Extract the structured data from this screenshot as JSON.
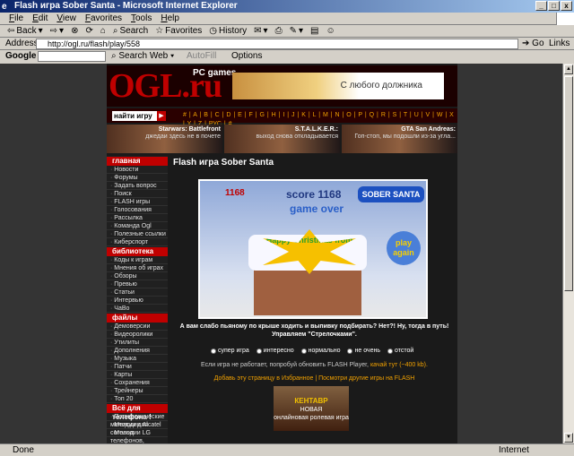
{
  "window": {
    "title": "Flash игра Sober Santa - Microsoft Internet Explorer",
    "buttons": [
      "_",
      "□",
      "x"
    ]
  },
  "menu": [
    "File",
    "Edit",
    "View",
    "Favorites",
    "Tools",
    "Help"
  ],
  "toolbar": {
    "back": "Back",
    "search": "Search",
    "favorites": "Favorites",
    "history": "History"
  },
  "address": {
    "label": "Address",
    "url": "http://ogl.ru/flash/play/558",
    "go": "Go",
    "links": "Links"
  },
  "google": {
    "label": "Google",
    "search_web": "Search Web",
    "autofill": "AutoFill",
    "options": "Options"
  },
  "site": {
    "logo": "OGL.ru",
    "logo_sub": "PC games",
    "banner": "С любого должника",
    "search_label": "найти игру",
    "alphabet": "# | A | B | C | D | E | F | G | H | I | J | K | L | M | N | O | P | Q | R | S | T | U | V | W | X | Y | Z | РУС | #",
    "promos": [
      {
        "title": "Starwars: Battlefront",
        "text": "джедаи здесь не в почете"
      },
      {
        "title": "S.T.A.L.K.E.R.:",
        "text": "выход снова откладывается"
      },
      {
        "title": "GTA San Andreas:",
        "text": "Гоп-стоп, мы подошли из-за угла..."
      }
    ],
    "sidebar": [
      {
        "section": "главная",
        "items": [
          "Новости",
          "Форумы",
          "Задать вопрос",
          "Поиск",
          "FLASH игры",
          "Голосования",
          "Рассылка",
          "Команда Ogl",
          "Полезные ссылки",
          "Киберспорт"
        ]
      },
      {
        "section": "библиотека",
        "items": [
          "Коды к играм",
          "Мнения об играх",
          "Обзоры",
          "Превью",
          "Статьи",
          "Интервью",
          "ЧаВо"
        ]
      },
      {
        "section": "файлы",
        "items": [
          "Демоверсии",
          "Видеоролики",
          "Утилиты",
          "Дополнения",
          "Музыка",
          "Патчи",
          "Карты",
          "Сохранения",
          "Трейнеры",
          "Топ 20"
        ]
      },
      {
        "section": "Всё для телефона !",
        "items": [
          "Полифонические мелодии для сотовых телефонов, картинки",
          "Мелодии Alcatel",
          "Мелодии LG"
        ]
      }
    ],
    "page_title": "Flash игра Sober Santa",
    "game": {
      "highscore": "1168",
      "score_label": "score 1168",
      "game_over": "game over",
      "brand": "SOBER SANTA",
      "greeting": "Happy Christmas from",
      "play": "play again"
    },
    "description": "А вам слабо пьяному по крыше ходить и выпивку подбирать? Нет?! Ну, тогда в путь! Управляем \"Стрелочками\".",
    "rating": [
      "супер игра",
      "интересно",
      "нормально",
      "не очень",
      "отстой"
    ],
    "flash_note": "Если игра не работает, попробуй обновить FLASH Player,",
    "flash_link": "качай тут (~400 kb).",
    "fav_links": "Добавь эту страницу в Избранное | Посмотри другие игры на FLASH",
    "ad": {
      "title": "КЕНТАВР",
      "sub": "НОВАЯ",
      "text": "онлайновая ролевая игра"
    }
  },
  "status": {
    "text": "Done",
    "zone": "Internet"
  }
}
